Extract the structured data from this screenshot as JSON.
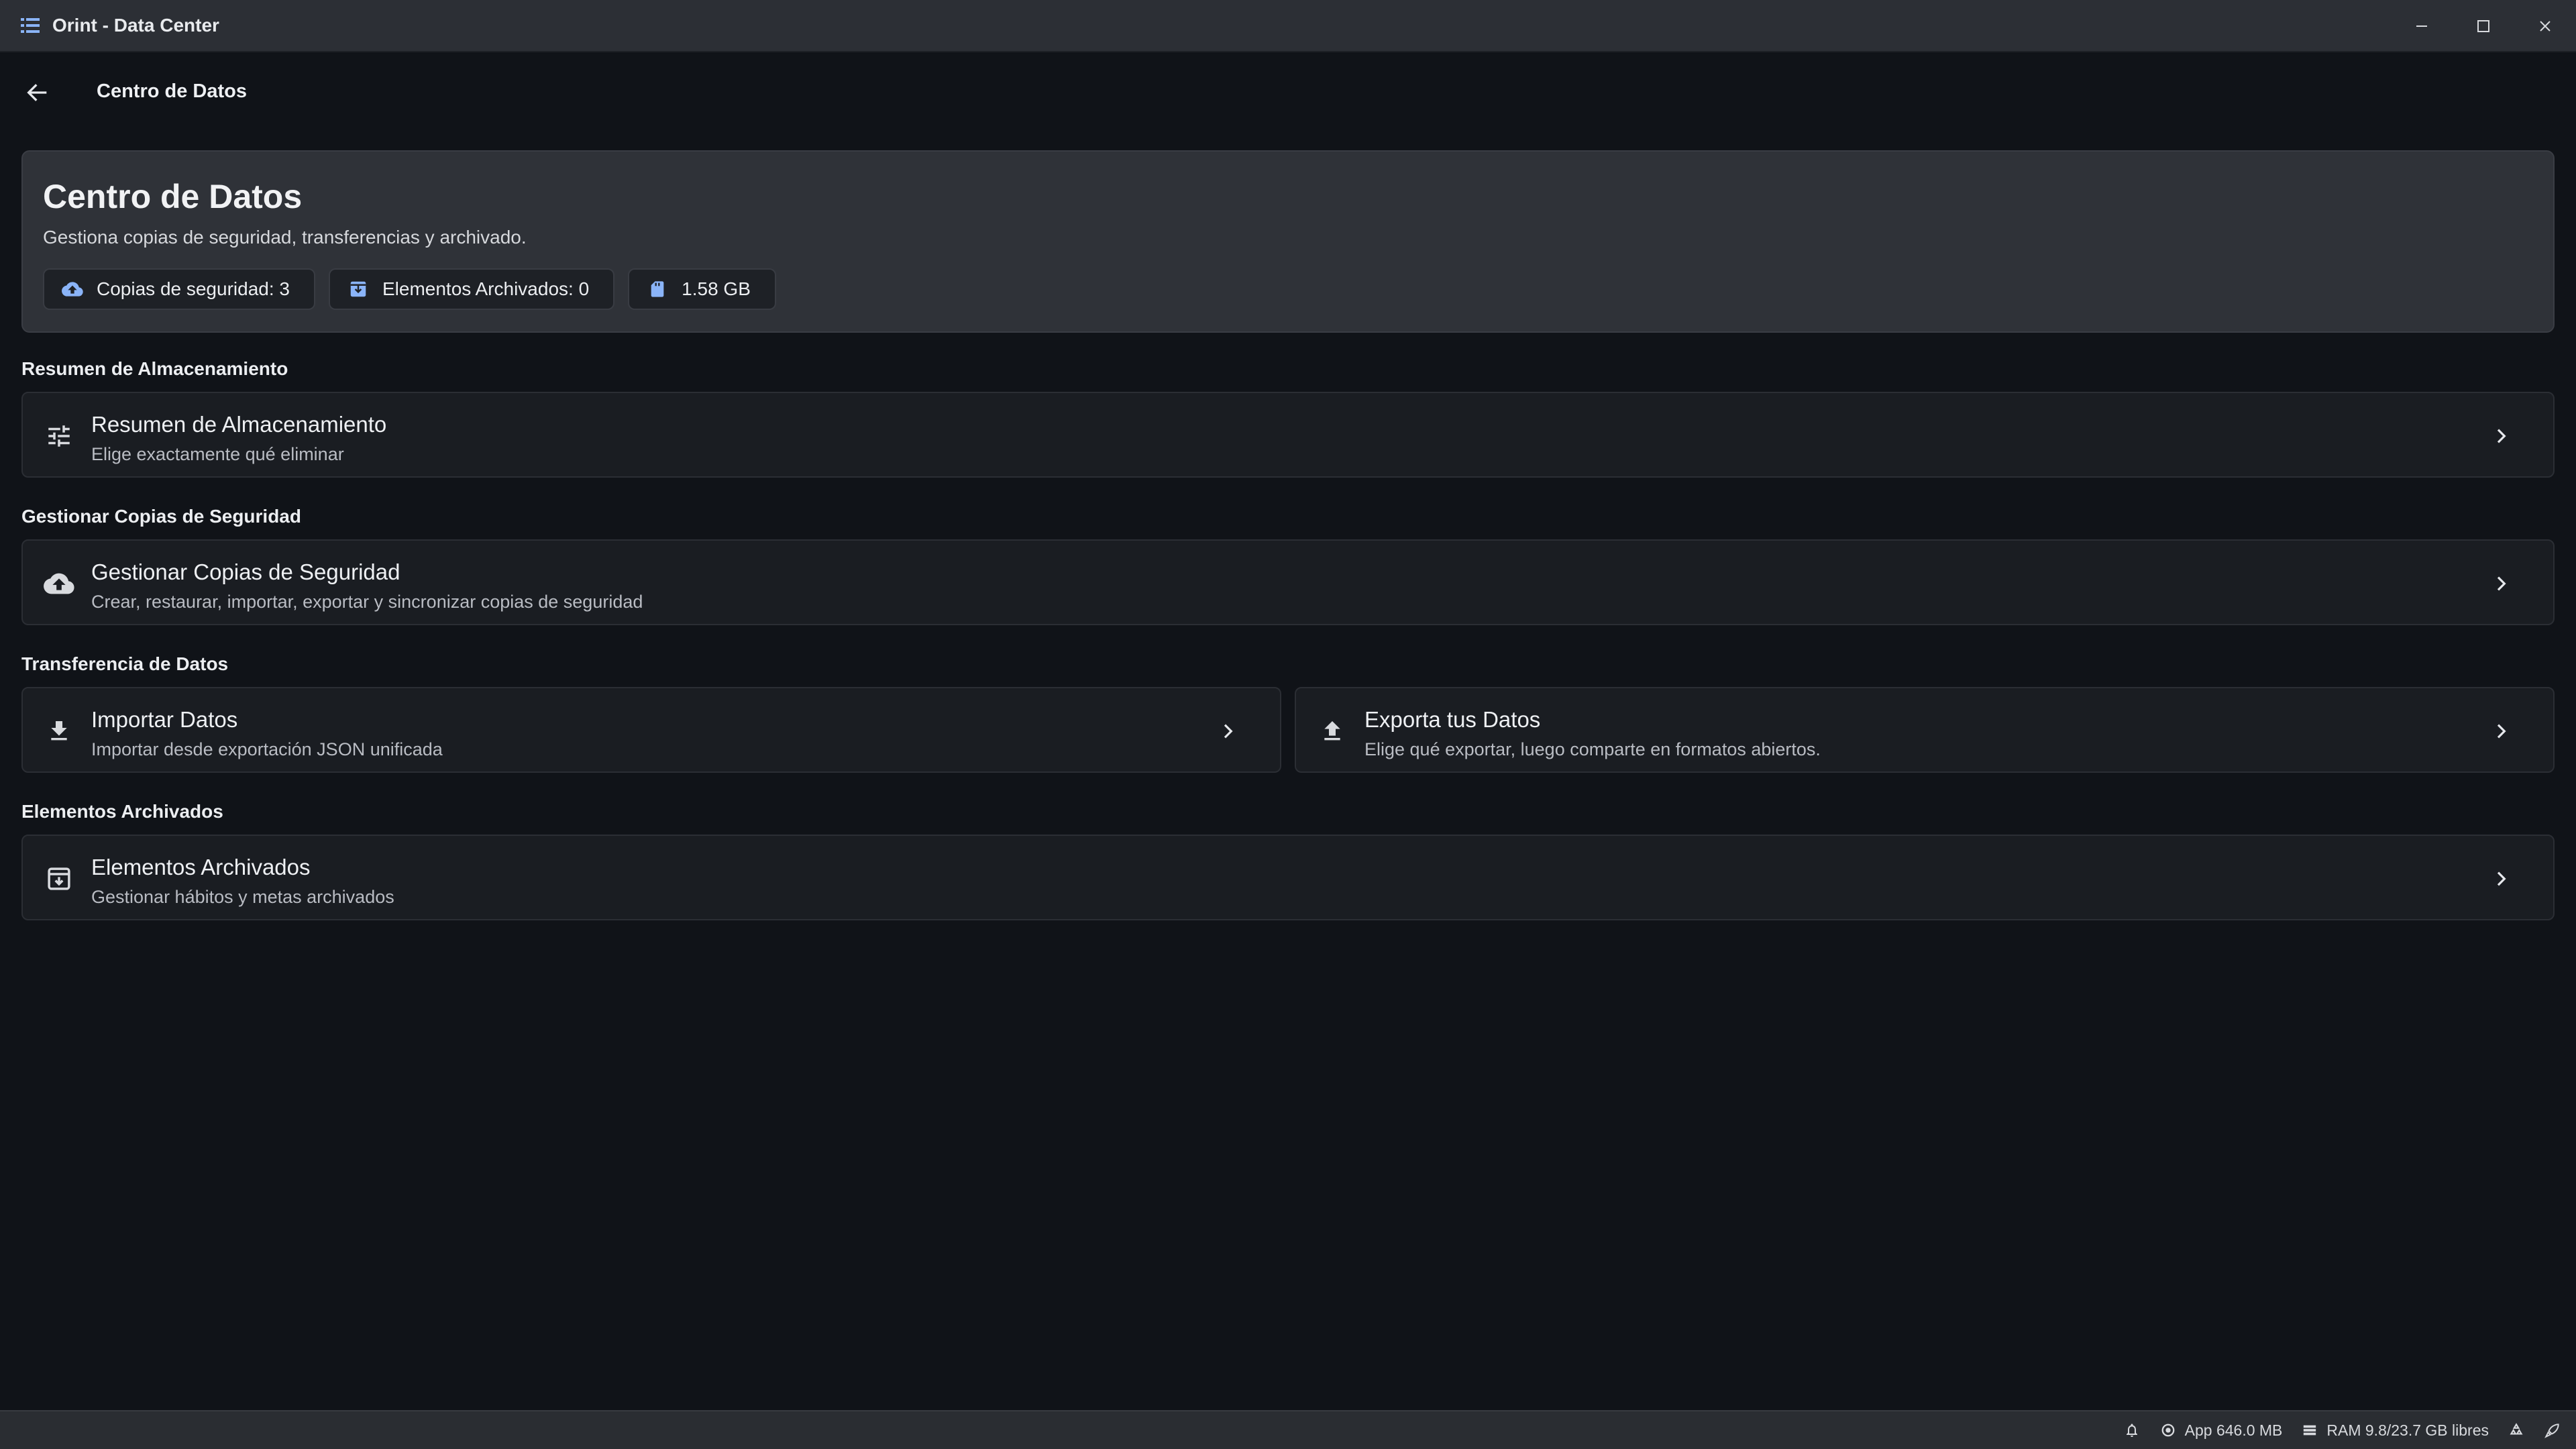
{
  "window": {
    "title": "Orint - Data Center"
  },
  "nav": {
    "title": "Centro de Datos"
  },
  "hero": {
    "title": "Centro de Datos",
    "subtitle": "Gestiona copias de seguridad, transferencias y archivado.",
    "chips": [
      {
        "label": "Copias de seguridad: 3",
        "icon": "cloud-upload-icon"
      },
      {
        "label": "Elementos Archivados: 0",
        "icon": "archive-icon"
      },
      {
        "label": "1.58 GB",
        "icon": "sd-card-icon"
      }
    ]
  },
  "sections": {
    "storage": {
      "label": "Resumen de Almacenamiento",
      "card": {
        "title": "Resumen de Almacenamiento",
        "subtitle": "Elige exactamente qué eliminar",
        "icon": "tune-icon"
      }
    },
    "backups": {
      "label": "Gestionar Copias de Seguridad",
      "card": {
        "title": "Gestionar Copias de Seguridad",
        "subtitle": "Crear, restaurar, importar, exportar y sincronizar copias de seguridad",
        "icon": "cloud-upload-icon"
      }
    },
    "transfer": {
      "label": "Transferencia de Datos",
      "import": {
        "title": "Importar Datos",
        "subtitle": "Importar desde exportación JSON unificada",
        "icon": "download-icon"
      },
      "export": {
        "title": "Exporta tus Datos",
        "subtitle": "Elige qué exportar, luego comparte en formatos abiertos.",
        "icon": "upload-icon"
      }
    },
    "archived": {
      "label": "Elementos Archivados",
      "card": {
        "title": "Elementos Archivados",
        "subtitle": "Gestionar hábitos y metas archivados",
        "icon": "archive-icon"
      }
    }
  },
  "statusbar": {
    "app_memory": "App 646.0 MB",
    "ram": "RAM 9.8/23.7 GB libres"
  },
  "colors": {
    "background": "#101318",
    "card": "#1a1d22",
    "hero": "#2f3238",
    "titlebar": "#2c2f35",
    "accent": "#8ab4f8"
  }
}
